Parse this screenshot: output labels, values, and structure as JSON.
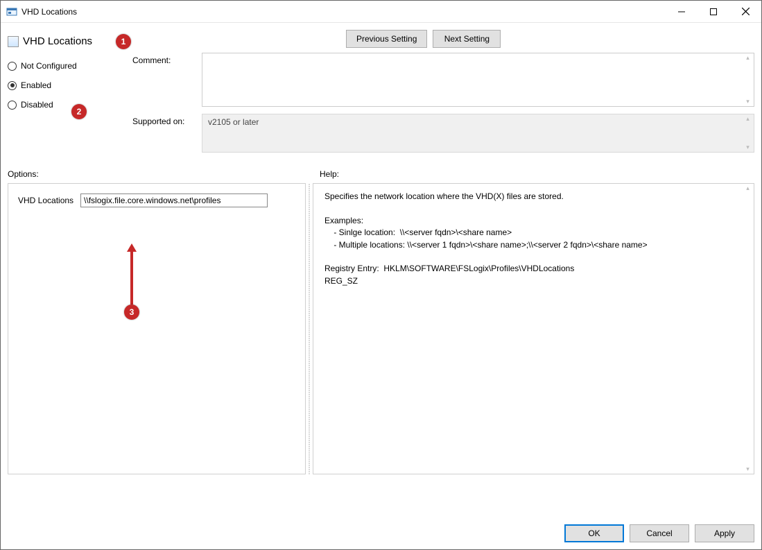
{
  "window": {
    "title": "VHD Locations"
  },
  "header": {
    "setting_name": "VHD Locations",
    "prev_btn": "Previous Setting",
    "next_btn": "Next Setting"
  },
  "state_radios": {
    "not_configured": "Not Configured",
    "enabled": "Enabled",
    "disabled": "Disabled",
    "selected": "enabled"
  },
  "fields": {
    "comment_label": "Comment:",
    "comment_value": "",
    "supported_label": "Supported on:",
    "supported_value": "v2105 or later"
  },
  "panels": {
    "options_label": "Options:",
    "help_label": "Help:"
  },
  "options": {
    "vhd_locations_label": "VHD Locations",
    "vhd_locations_value": "\\\\fslogix.file.core.windows.net\\profiles"
  },
  "help_text": "Specifies the network location where the VHD(X) files are stored.\n\nExamples:\n    - Sinlge location:  \\\\<server fqdn>\\<share name>\n    - Multiple locations: \\\\<server 1 fqdn>\\<share name>;\\\\<server 2 fqdn>\\<share name>\n\nRegistry Entry:  HKLM\\SOFTWARE\\FSLogix\\Profiles\\VHDLocations\nREG_SZ",
  "buttons": {
    "ok": "OK",
    "cancel": "Cancel",
    "apply": "Apply"
  },
  "callouts": {
    "one": "1",
    "two": "2",
    "three": "3"
  }
}
